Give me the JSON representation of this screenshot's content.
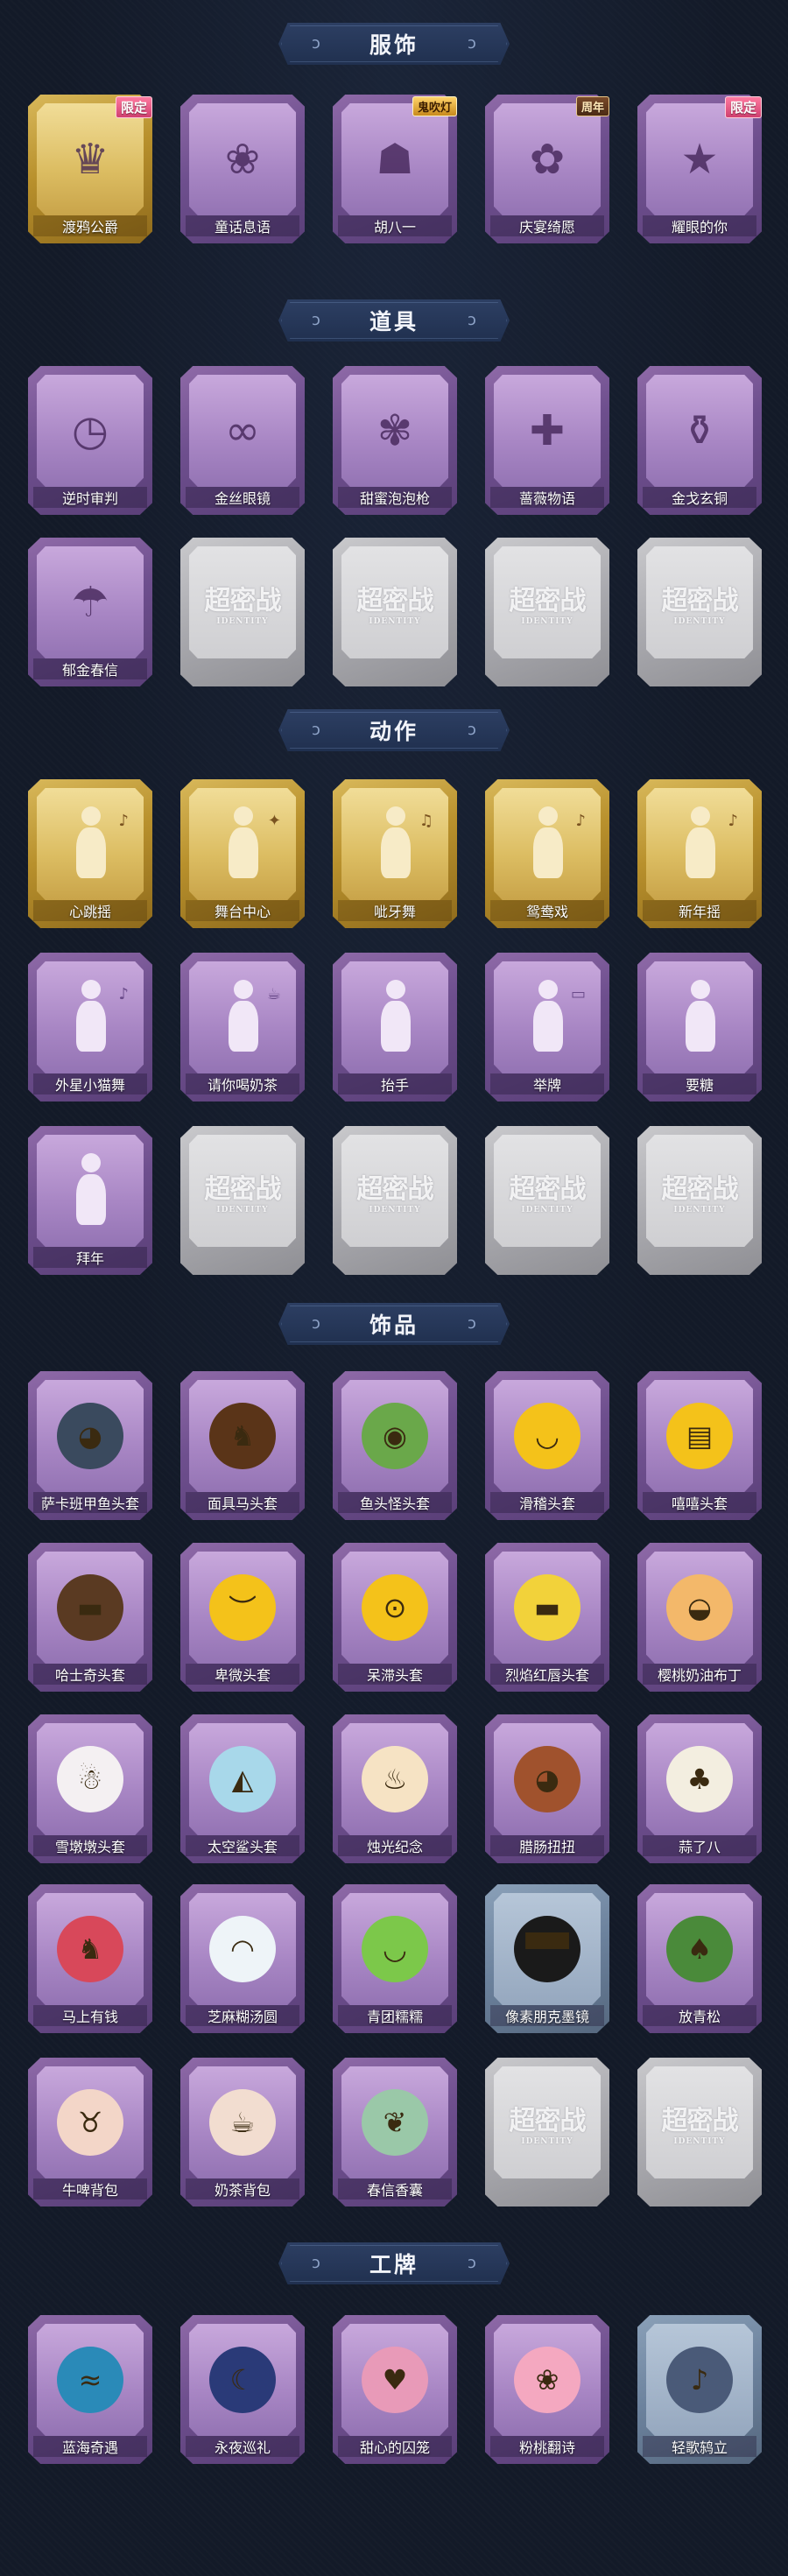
{
  "sections": [
    {
      "title": "服饰",
      "items": [
        {
          "label": "渡鸦公爵",
          "style": "gold",
          "badge": "限定",
          "icon": "duke-portrait-icon",
          "glyph": "♛"
        },
        {
          "label": "童话息语",
          "style": "purple",
          "icon": "fairy-girl-portrait-icon",
          "glyph": "❀"
        },
        {
          "label": "胡八一",
          "style": "purple",
          "badge": "鬼吹灯",
          "badge_type": "event",
          "icon": "explorer-portrait-icon",
          "glyph": "☗"
        },
        {
          "label": "庆宴绮愿",
          "style": "purple",
          "badge": "周年",
          "badge_type": "anniv",
          "icon": "party-cake-portrait-icon",
          "glyph": "✿"
        },
        {
          "label": "耀眼的你",
          "style": "purple",
          "badge": "限定",
          "icon": "cowgirl-portrait-icon",
          "glyph": "★"
        }
      ]
    },
    {
      "title": "道具",
      "items": [
        {
          "label": "逆时审判",
          "style": "purple",
          "icon": "pocket-watch-icon",
          "glyph": "◷"
        },
        {
          "label": "金丝眼镜",
          "style": "purple",
          "icon": "glasses-icon",
          "glyph": "∞"
        },
        {
          "label": "甜蜜泡泡枪",
          "style": "purple",
          "icon": "bubble-gun-icon",
          "glyph": "✾"
        },
        {
          "label": "蔷薇物语",
          "style": "purple",
          "icon": "first-aid-box-icon",
          "glyph": "✚"
        },
        {
          "label": "金戈玄铜",
          "style": "purple",
          "icon": "flask-icon",
          "glyph": "⚱"
        },
        {
          "label": "郁金春信",
          "style": "purple",
          "icon": "paper-umbrella-icon",
          "glyph": "☂"
        },
        {
          "placeholder": true,
          "style": "gray",
          "mark": "超密战",
          "sub": "IDENTITY"
        },
        {
          "placeholder": true,
          "style": "gray",
          "mark": "超密战",
          "sub": "IDENTITY"
        },
        {
          "placeholder": true,
          "style": "gray",
          "mark": "超密战",
          "sub": "IDENTITY"
        },
        {
          "placeholder": true,
          "style": "gray",
          "mark": "超密战",
          "sub": "IDENTITY"
        }
      ]
    },
    {
      "title": "动作",
      "items": [
        {
          "label": "心跳摇",
          "style": "gold",
          "icon": "heart-dance-emote-icon",
          "glyph": "♪",
          "emote": true
        },
        {
          "label": "舞台中心",
          "style": "gold",
          "icon": "stage-center-emote-icon",
          "glyph": "✦",
          "emote": true
        },
        {
          "label": "呲牙舞",
          "style": "gold",
          "icon": "grin-dance-emote-icon",
          "glyph": "♫",
          "emote": true
        },
        {
          "label": "鸳鸯戏",
          "style": "gold",
          "icon": "mandarin-duck-emote-icon",
          "glyph": "♪",
          "emote": true
        },
        {
          "label": "新年摇",
          "style": "gold",
          "icon": "new-year-dance-emote-icon",
          "glyph": "♪",
          "emote": true
        },
        {
          "label": "外星小猫舞",
          "style": "purple",
          "icon": "alien-cat-dance-emote-icon",
          "glyph": "♪",
          "emote": true
        },
        {
          "label": "请你喝奶茶",
          "style": "purple",
          "icon": "milk-tea-emote-icon",
          "glyph": "☕",
          "emote": true
        },
        {
          "label": "抬手",
          "style": "purple",
          "icon": "raise-hand-emote-icon",
          "glyph": "",
          "emote": true
        },
        {
          "label": "举牌",
          "style": "purple",
          "icon": "hold-sign-emote-icon",
          "glyph": "▭",
          "emote": true
        },
        {
          "label": "要糖",
          "style": "purple",
          "icon": "ask-candy-emote-icon",
          "glyph": "",
          "emote": true
        },
        {
          "label": "拜年",
          "style": "purple",
          "icon": "new-year-greeting-emote-icon",
          "glyph": "",
          "emote": true
        },
        {
          "placeholder": true,
          "style": "gray",
          "mark": "超密战",
          "sub": "IDENTITY"
        },
        {
          "placeholder": true,
          "style": "gray",
          "mark": "超密战",
          "sub": "IDENTITY"
        },
        {
          "placeholder": true,
          "style": "gray",
          "mark": "超密战",
          "sub": "IDENTITY"
        },
        {
          "placeholder": true,
          "style": "gray",
          "mark": "超密战",
          "sub": "IDENTITY"
        }
      ]
    },
    {
      "title": "饰品",
      "items": [
        {
          "label": "萨卡班甲鱼头套",
          "style": "purple",
          "icon": "fish-head-icon",
          "glyph": "◕",
          "face": "#3a4a5e"
        },
        {
          "label": "面具马头套",
          "style": "purple",
          "icon": "horse-head-icon",
          "glyph": "♞",
          "face": "#5a3418"
        },
        {
          "label": "鱼头怪头套",
          "style": "purple",
          "icon": "fish-monster-head-icon",
          "glyph": "◉",
          "face": "#6aa84a"
        },
        {
          "label": "滑稽头套",
          "style": "purple",
          "icon": "funny-face-head-icon",
          "glyph": "◡",
          "face": "#f4c21a"
        },
        {
          "label": "嘻嘻头套",
          "style": "purple",
          "icon": "grin-face-head-icon",
          "glyph": "▤",
          "face": "#f4c21a"
        },
        {
          "label": "哈士奇头套",
          "style": "purple",
          "icon": "husky-head-icon",
          "glyph": "▬",
          "face": "#5a3a22"
        },
        {
          "label": "卑微头套",
          "style": "purple",
          "icon": "humble-face-head-icon",
          "glyph": "︶",
          "face": "#f4c21a"
        },
        {
          "label": "呆滞头套",
          "style": "purple",
          "icon": "blank-face-head-icon",
          "glyph": "⊙",
          "face": "#f4c21a"
        },
        {
          "label": "烈焰红唇头套",
          "style": "purple",
          "icon": "red-lips-head-icon",
          "glyph": "▬",
          "face": "#f2d23a"
        },
        {
          "label": "樱桃奶油布丁",
          "style": "purple",
          "icon": "pudding-head-icon",
          "glyph": "◒",
          "face": "#f3b86a"
        },
        {
          "label": "雪墩墩头套",
          "style": "purple",
          "icon": "snowman-head-icon",
          "glyph": "☃",
          "face": "#f4f0f2"
        },
        {
          "label": "太空鲨头套",
          "style": "purple",
          "icon": "space-shark-head-icon",
          "glyph": "◭",
          "face": "#a8d8ea"
        },
        {
          "label": "烛光纪念",
          "style": "purple",
          "icon": "candle-head-icon",
          "glyph": "♨",
          "face": "#f6e3c4"
        },
        {
          "label": "腊肠扭扭",
          "style": "purple",
          "icon": "dachshund-head-icon",
          "glyph": "◕",
          "face": "#a0522d"
        },
        {
          "label": "蒜了八",
          "style": "purple",
          "icon": "garlic-head-icon",
          "glyph": "♣",
          "face": "#f3eee0"
        },
        {
          "label": "马上有钱",
          "style": "purple",
          "icon": "lucky-horse-head-icon",
          "glyph": "♞",
          "face": "#d8485a"
        },
        {
          "label": "芝麻糊汤圆",
          "style": "purple",
          "icon": "rice-ball-head-icon",
          "glyph": "◠",
          "face": "#eef4f8"
        },
        {
          "label": "青团糯糯",
          "style": "purple",
          "icon": "green-dumpling-head-icon",
          "glyph": "◡",
          "face": "#7cc84a"
        },
        {
          "label": "像素朋克墨镜",
          "style": "blue",
          "icon": "pixel-sunglasses-icon",
          "glyph": "▀▀",
          "face": "#1a1a1a"
        },
        {
          "label": "放青松",
          "style": "purple",
          "icon": "bonsai-pine-icon",
          "glyph": "♠",
          "face": "#4a8a3a"
        },
        {
          "label": "牛啤背包",
          "style": "purple",
          "icon": "cow-backpack-icon",
          "glyph": "♉",
          "face": "#f3d6c8"
        },
        {
          "label": "奶茶背包",
          "style": "purple",
          "icon": "milk-tea-backpack-icon",
          "glyph": "☕",
          "face": "#f2ddd0"
        },
        {
          "label": "春信香囊",
          "style": "purple",
          "icon": "sachet-pouch-icon",
          "glyph": "❦",
          "face": "#9ac8a8"
        },
        {
          "placeholder": true,
          "style": "gray",
          "mark": "超密战",
          "sub": "IDENTITY"
        },
        {
          "placeholder": true,
          "style": "gray",
          "mark": "超密战",
          "sub": "IDENTITY"
        }
      ]
    },
    {
      "title": "工牌",
      "items": [
        {
          "label": "蓝海奇遇",
          "style": "purple",
          "icon": "blue-sea-badge-icon",
          "glyph": "≈",
          "face": "#2a8ab8"
        },
        {
          "label": "永夜巡礼",
          "style": "purple",
          "icon": "eternal-night-badge-icon",
          "glyph": "☾",
          "face": "#2a3a78"
        },
        {
          "label": "甜心的囚笼",
          "style": "purple",
          "icon": "sweetheart-cage-badge-icon",
          "glyph": "♥",
          "face": "#e89ab8"
        },
        {
          "label": "粉桃翻诗",
          "style": "purple",
          "icon": "pink-peach-badge-icon",
          "glyph": "❀",
          "face": "#f4a8c0"
        },
        {
          "label": "轻歌鸫立",
          "style": "blue",
          "icon": "light-song-badge-icon",
          "glyph": "♪",
          "face": "#4a5a78"
        }
      ]
    }
  ],
  "swirl_glyph": "ↄ"
}
